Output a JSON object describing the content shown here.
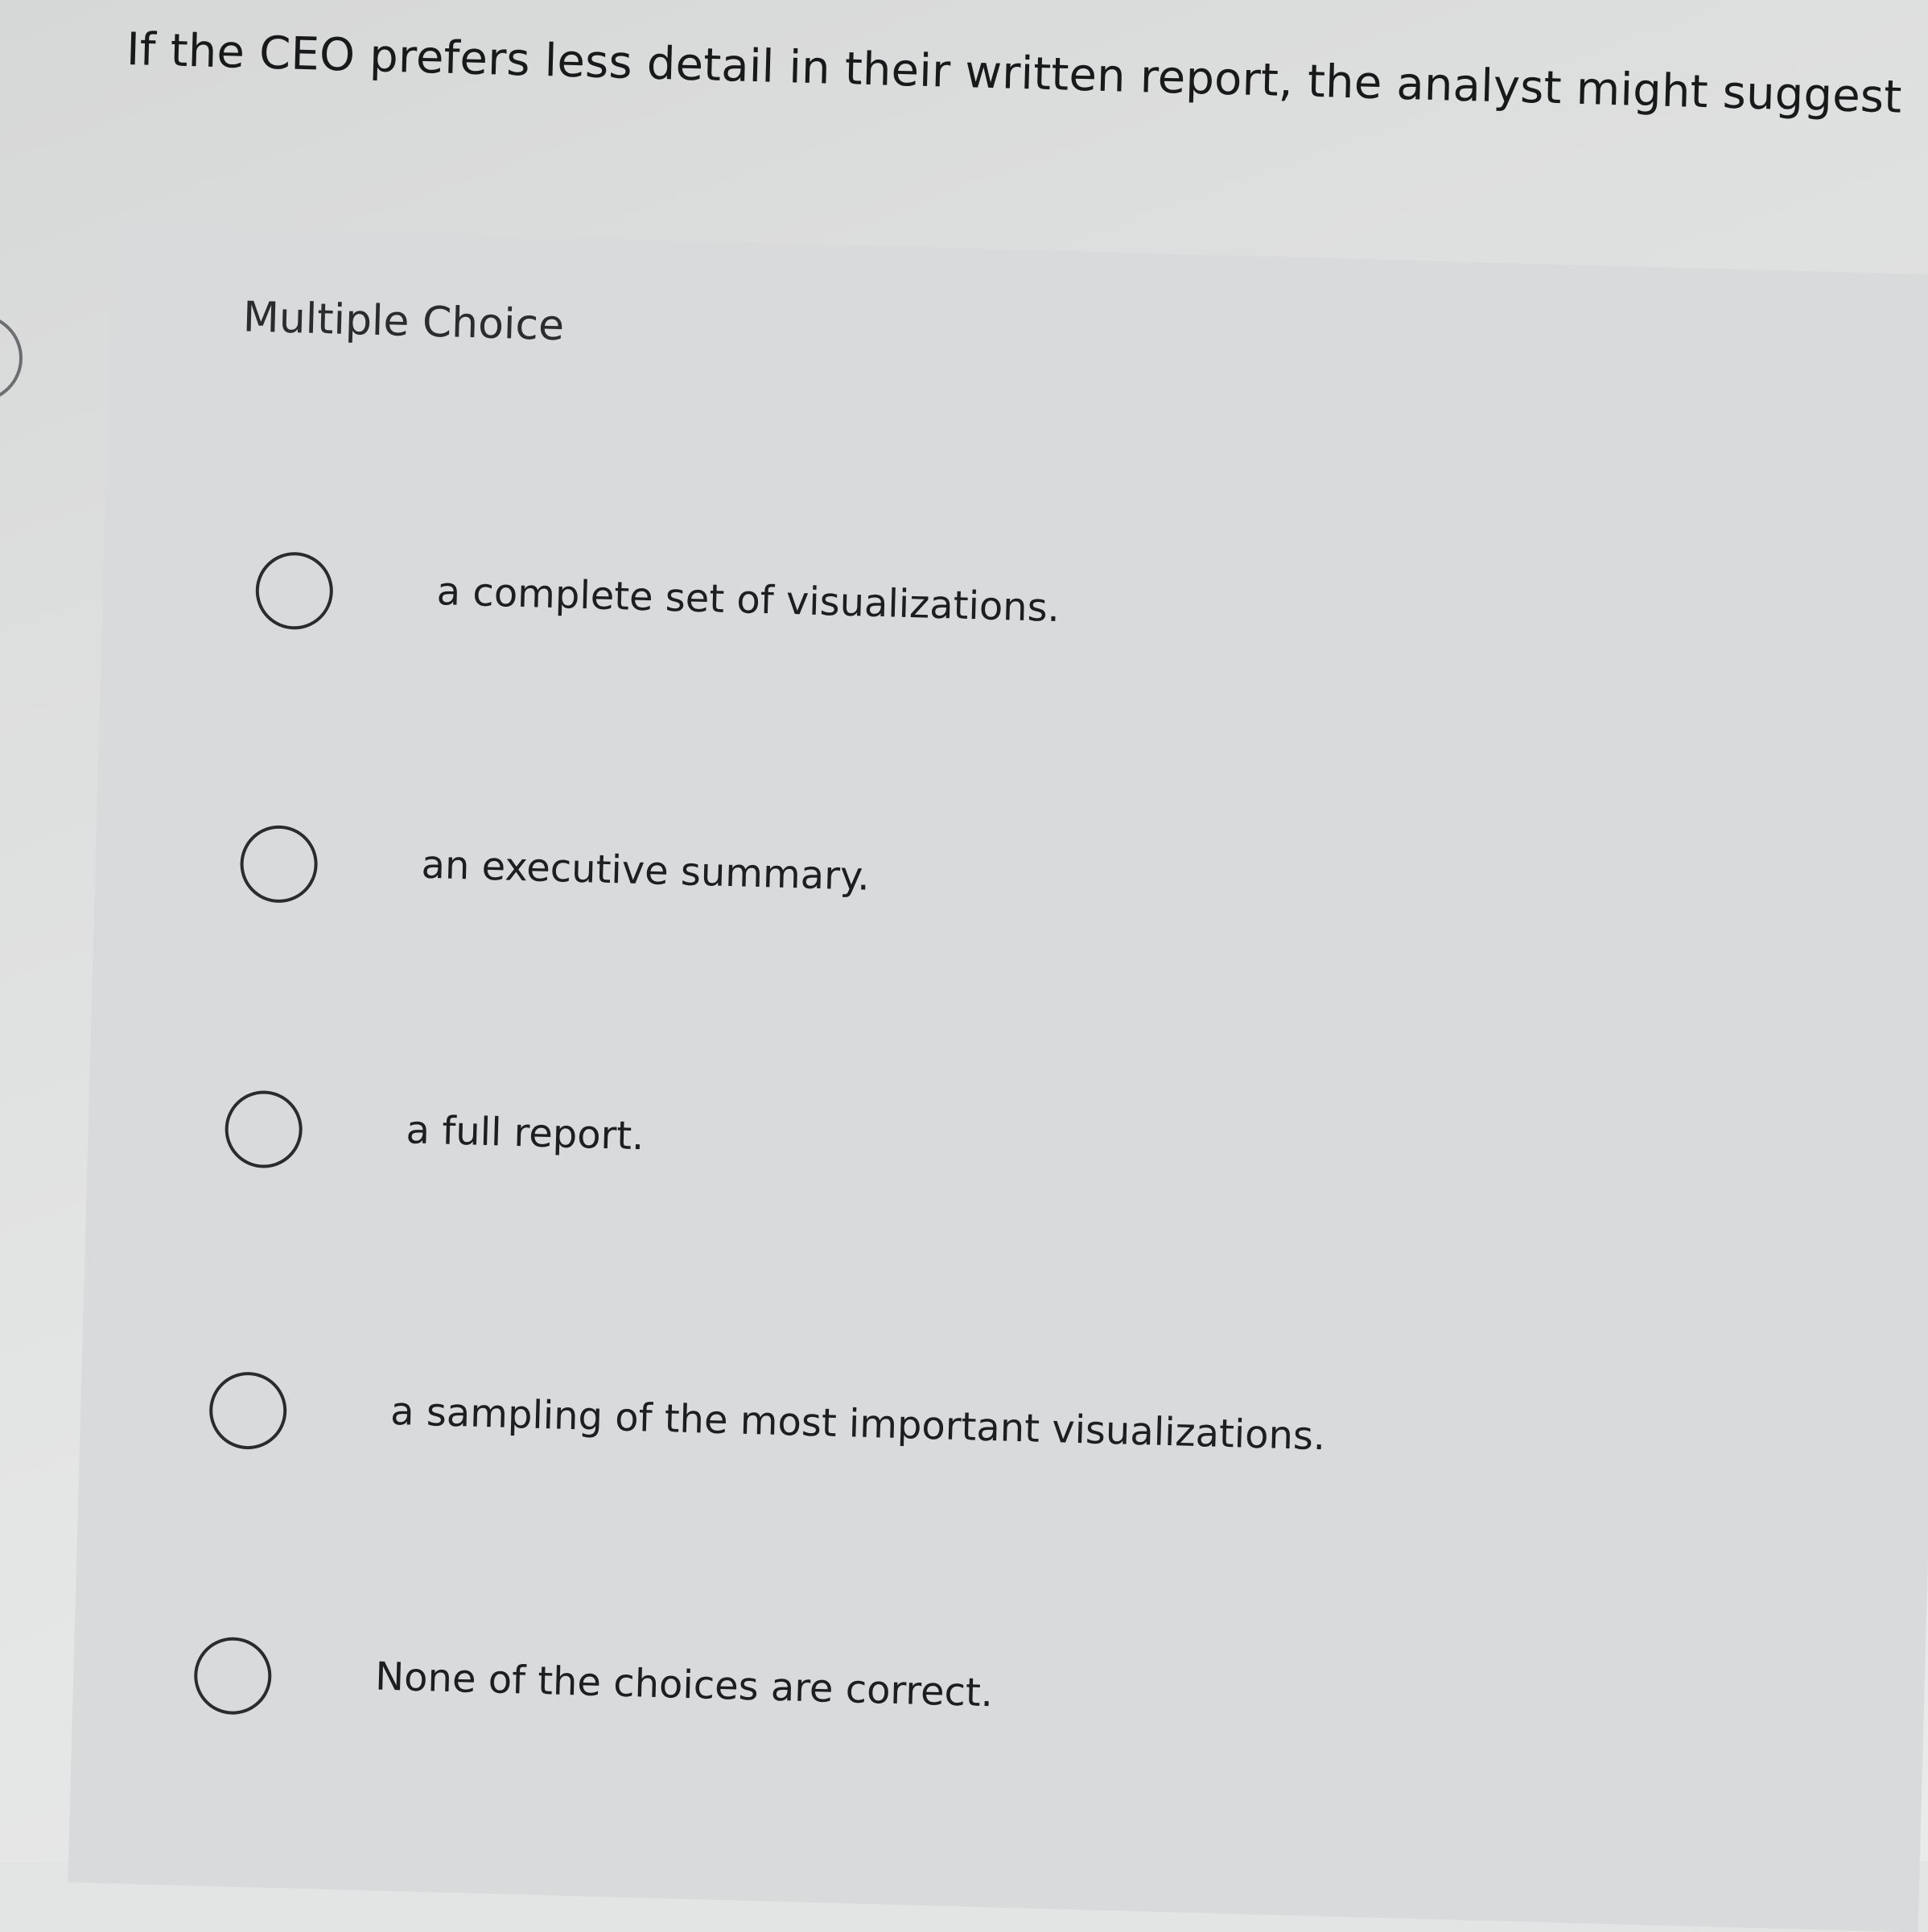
{
  "question": {
    "text": "If the CEO prefers less detail in their written report, the analyst might suggest"
  },
  "panel": {
    "heading": "Multiple Choice"
  },
  "choices": [
    {
      "label": "a complete set of visualizations."
    },
    {
      "label": "an executive summary."
    },
    {
      "label": "a full report."
    },
    {
      "label": "a sampling of the most important visualizations."
    },
    {
      "label": "None of the choices are correct."
    }
  ]
}
